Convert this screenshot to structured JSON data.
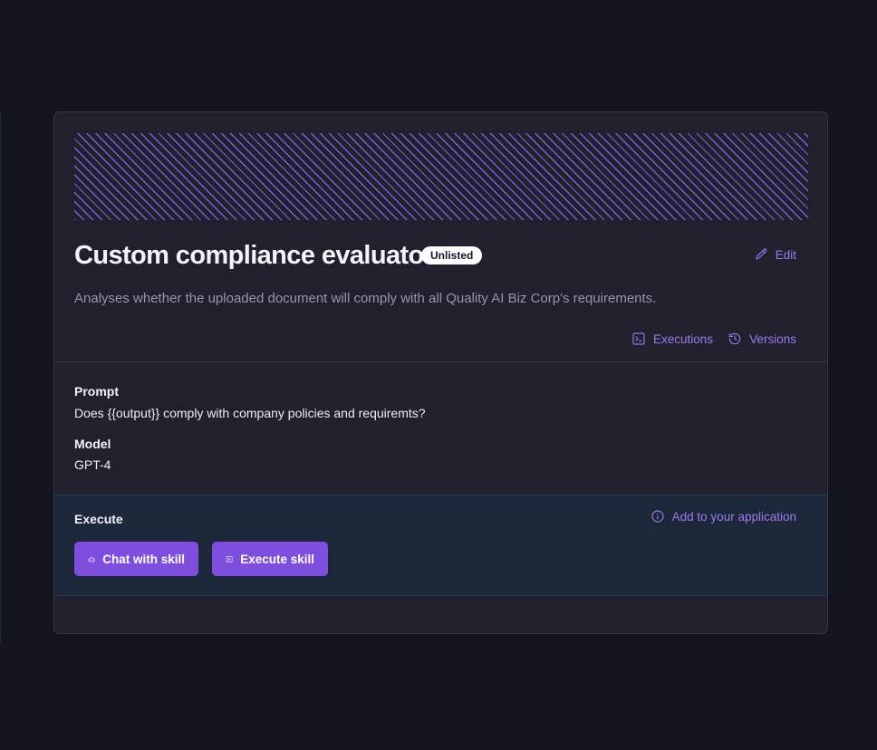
{
  "skill": {
    "title": "Custom compliance evaluator",
    "visibility_badge": "Unlisted",
    "description": "Analyses whether the uploaded document will comply with all Quality AI Biz Corp's requirements."
  },
  "actions": {
    "edit_label": "Edit",
    "executions_label": "Executions",
    "versions_label": "Versions"
  },
  "details": {
    "prompt_label": "Prompt",
    "prompt_value": "Does {{output}} comply with company policies and requiremts?",
    "model_label": "Model",
    "model_value": "GPT-4"
  },
  "execute": {
    "section_label": "Execute",
    "add_to_app_label": "Add to your application",
    "chat_button_label": "Chat with skill",
    "execute_button_label": "Execute skill"
  },
  "icons": {
    "edit": "pencil-icon",
    "executions": "terminal-icon",
    "versions": "history-icon",
    "add_to_app": "info-icon",
    "chat": "robot-icon",
    "execute": "play-square-icon"
  },
  "colors": {
    "accent": "#9a7bf0",
    "button": "#7e4fdf",
    "card_background": "#21212d",
    "execute_background": "#1c2739"
  }
}
